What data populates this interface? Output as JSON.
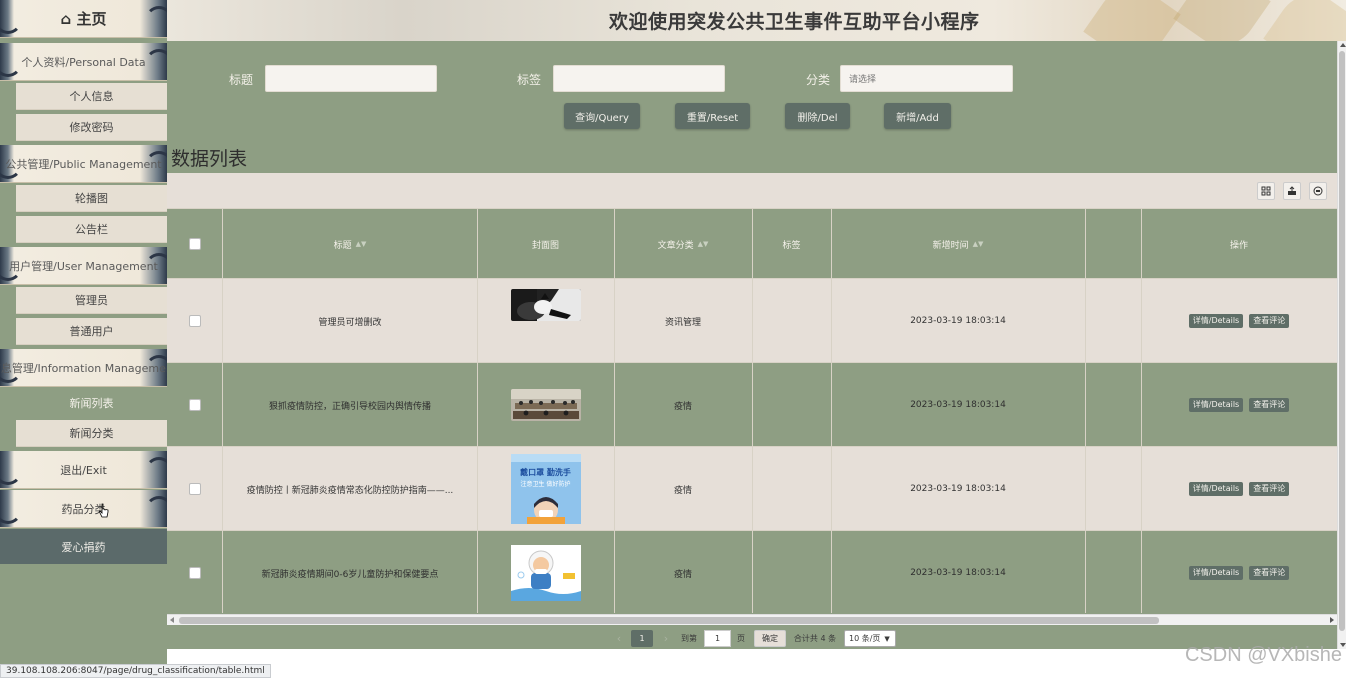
{
  "header": {
    "title": "欢迎使用突发公共卫生事件互助平台小程序"
  },
  "sidebar": {
    "home": "⌂ 主页",
    "group_personal": "个人资料/Personal Data",
    "item_personal_info": "个人信息",
    "item_change_pwd": "修改密码",
    "group_public": "公共管理/Public Management",
    "item_carousel": "轮播图",
    "item_notice": "公告栏",
    "group_user": "用户管理/User Management",
    "item_admin": "管理员",
    "item_normal_user": "普通用户",
    "group_info": "信息管理/Information Management",
    "item_news_list": "新闻列表",
    "item_news_category": "新闻分类",
    "exit": "退出/Exit",
    "drug_category": "药品分类",
    "love_donation": "爱心捐药"
  },
  "search": {
    "title_label": "标题",
    "tag_label": "标签",
    "category_label": "分类",
    "category_placeholder": "请选择",
    "query_btn": "查询/Query",
    "reset_btn": "重置/Reset",
    "delete_btn": "删除/Del",
    "add_btn": "新增/Add"
  },
  "list_title": "数据列表",
  "table": {
    "columns": [
      "标题",
      "封面图",
      "文章分类",
      "标签",
      "新增时间",
      "操作"
    ],
    "rows": [
      {
        "title": "管理员可增删改",
        "category": "资讯管理",
        "tag": "",
        "time": "2023-03-19 18:03:14"
      },
      {
        "title": "狠抓疫情防控，正确引导校园内舆情传播",
        "category": "疫情",
        "tag": "",
        "time": "2023-03-19 18:03:14"
      },
      {
        "title": "疫情防控丨新冠肺炎疫情常态化防控防护指南——...",
        "category": "疫情",
        "tag": "",
        "time": "2023-03-19 18:03:14"
      },
      {
        "title": "新冠肺炎疫情期间0-6岁儿童防护和保健要点",
        "category": "疫情",
        "tag": "",
        "time": "2023-03-19 18:03:14"
      }
    ],
    "details_btn": "详情/Details",
    "comments_btn": "查看评论"
  },
  "pagination": {
    "current_page": "1",
    "goto_label": "到第",
    "goto_value": "1",
    "page_unit": "页",
    "confirm": "确定",
    "total": "合计共 4 条",
    "page_size": "10 条/页"
  },
  "poster_text": {
    "line1": "戴口罩 勤洗手",
    "line2": "注意卫生 做好防护"
  },
  "statusbar": {
    "url": "39.108.108.206:8047/page/drug_classification/table.html"
  },
  "watermark": "CSDN @VXbishe",
  "colors": {
    "main_bg": "#8e9e83",
    "light_row": "#e6dfd8",
    "button": "#5f6e67",
    "sidebar_active": "#5b6a6a"
  }
}
